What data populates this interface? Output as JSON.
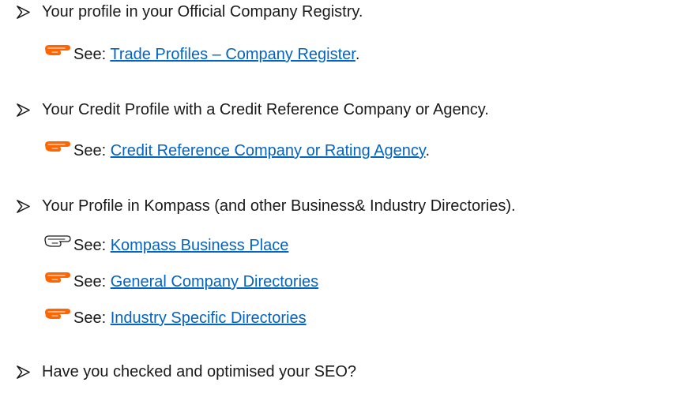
{
  "colors": {
    "text": "#1a1a1a",
    "link": "#0563c1",
    "hand_icon": "#ff6600"
  },
  "icons": {
    "bullet": "arrowhead-bullet-icon",
    "pointer": "pointing-hand-icon"
  },
  "items": [
    {
      "text": "Your profile in your Official Company Registry.",
      "refs": [
        {
          "prefix": "See: ",
          "link": "Trade Profiles – Company Register",
          "suffix": "."
        }
      ]
    },
    {
      "text": "Your Credit Profile with a Credit Reference Company or Agency.",
      "refs": [
        {
          "prefix": "See: ",
          "link": "Credit Reference Company or Rating Agency",
          "suffix": "."
        }
      ]
    },
    {
      "text": "Your Profile in Kompass (and other Business& Industry Directories).",
      "refs": [
        {
          "prefix": "See: ",
          "link": "Kompass Business Place",
          "suffix": ""
        },
        {
          "prefix": "See: ",
          "link": "General Company Directories",
          "suffix": ""
        },
        {
          "prefix": "See: ",
          "link": "Industry Specific Directories",
          "suffix": ""
        }
      ]
    },
    {
      "text": "Have you checked and optimised your SEO?",
      "refs": []
    }
  ]
}
